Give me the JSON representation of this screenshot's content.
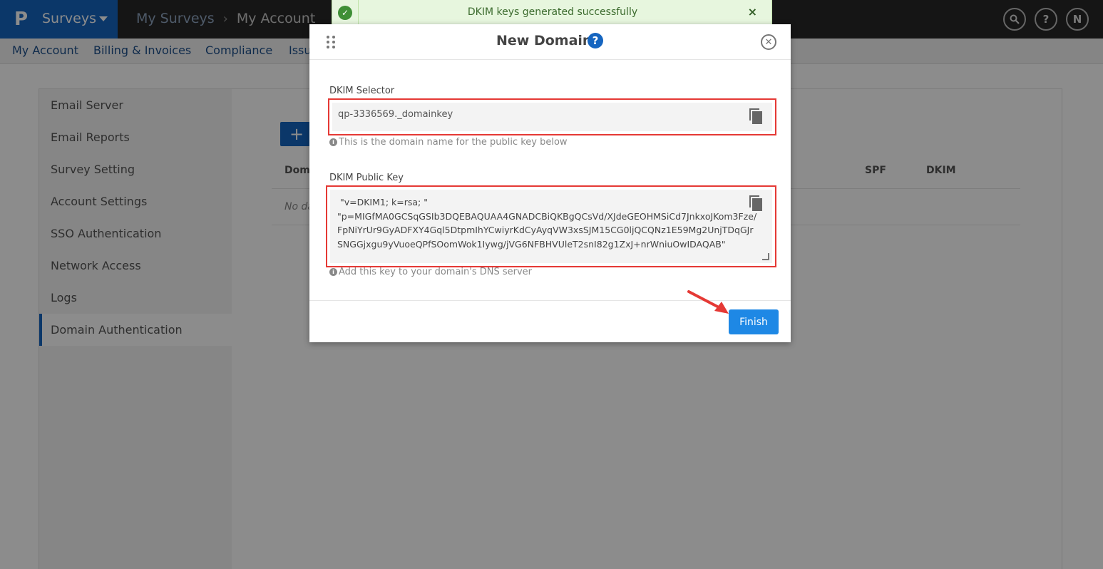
{
  "topbar": {
    "logo": "P",
    "product": "Surveys",
    "breadcrumb": [
      "My Surveys",
      "My Account"
    ],
    "icons": [
      "search-icon",
      "help-icon",
      "user-avatar"
    ],
    "avatar_initial": "N",
    "help_glyph": "?"
  },
  "subnav": {
    "items": [
      "My Account",
      "Billing & Invoices",
      "Compliance",
      "Issu"
    ]
  },
  "sidebar": {
    "items": [
      {
        "label": "Email Server"
      },
      {
        "label": "Email Reports"
      },
      {
        "label": "Survey Setting"
      },
      {
        "label": "Account Settings"
      },
      {
        "label": "SSO Authentication"
      },
      {
        "label": "Network Access"
      },
      {
        "label": "Logs"
      },
      {
        "label": "Domain Authentication",
        "active": true
      }
    ]
  },
  "main": {
    "add_label": "+",
    "table": {
      "columns": [
        "Doma",
        "SPF",
        "DKIM"
      ],
      "empty_text": "No da"
    }
  },
  "toast": {
    "message": "DKIM keys generated successfully",
    "close": "×",
    "check": "✓"
  },
  "modal": {
    "title": "New Domain",
    "help": "?",
    "close": "✕",
    "selector_label": "DKIM Selector",
    "selector_value": "qp-3336569._domainkey",
    "selector_hint": "This is the domain name for the public key below",
    "pubkey_label": "DKIM Public Key",
    "pubkey_value": " \"v=DKIM1; k=rsa; \"\n\"p=MIGfMA0GCSqGSIb3DQEBAQUAA4GNADCBiQKBgQCsVd/XJdeGEOHMSiCd7JnkxoJKom3Fze/FpNiYrUr9GyADFXY4Gql5DtpmIhYCwiyrKdCyAyqVW3xsSJM15CG0ljQCQNz1E59Mg2UnjTDqGJrSNGGjxgu9yVuoeQPfSOomWok1Iywg/jVG6NFBHVUleT2snI82g1ZxJ+nrWniuOwIDAQAB\"",
    "pubkey_hint": "Add this key to your domain's DNS server",
    "info_glyph": "i",
    "finish_label": "Finish"
  },
  "colors": {
    "brand": "#1565c0",
    "highlight_border": "#e53935",
    "finish_button": "#1e88e5",
    "toast_bg": "#e7f6de"
  }
}
